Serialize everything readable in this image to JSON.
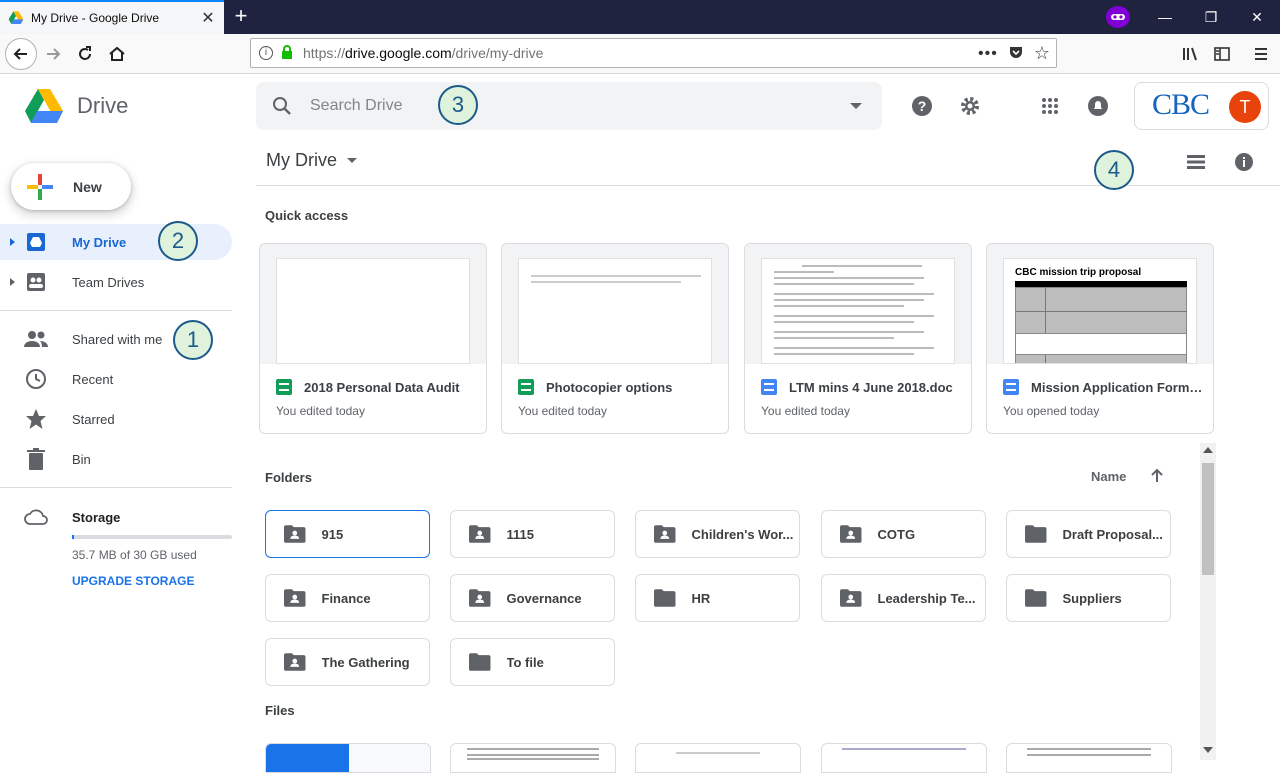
{
  "browser": {
    "tab_title": "My Drive - Google Drive",
    "url_prefix": "https://",
    "url_host": "drive.google.com",
    "url_path": "/drive/my-drive"
  },
  "header": {
    "app_name": "Drive",
    "search_placeholder": "Search Drive",
    "org_logo_text": "CBC",
    "avatar_letter": "T"
  },
  "sidebar": {
    "new_label": "New",
    "items": [
      {
        "label": "My Drive",
        "icon": "my-drive-icon",
        "active": true
      },
      {
        "label": "Team Drives",
        "icon": "team-drives-icon"
      },
      {
        "label": "Shared with me",
        "icon": "people-icon"
      },
      {
        "label": "Recent",
        "icon": "clock-icon"
      },
      {
        "label": "Starred",
        "icon": "star-icon"
      },
      {
        "label": "Bin",
        "icon": "trash-icon"
      }
    ],
    "storage": {
      "label": "Storage",
      "used_text": "35.7 MB of 30 GB used",
      "upgrade_label": "UPGRADE STORAGE"
    }
  },
  "main": {
    "breadcrumb": "My Drive",
    "quick_access_label": "Quick access",
    "quick_access": [
      {
        "name": "2018 Personal Data Audit",
        "type": "sheet",
        "sub": "You edited today"
      },
      {
        "name": "Photocopier options",
        "type": "sheet",
        "sub": "You edited today"
      },
      {
        "name": "LTM mins 4 June 2018.doc",
        "type": "doc",
        "sub": "You edited today"
      },
      {
        "name": "Mission Application Form ...",
        "type": "doc",
        "sub": "You opened today",
        "thumb_heading": "CBC mission trip proposal"
      }
    ],
    "folders_label": "Folders",
    "sort_label": "Name",
    "folders": [
      {
        "name": "915",
        "shared": true
      },
      {
        "name": "1115",
        "shared": true
      },
      {
        "name": "Children's Wor...",
        "shared": true
      },
      {
        "name": "COTG",
        "shared": true
      },
      {
        "name": "Draft Proposal...",
        "shared": false
      },
      {
        "name": "Finance",
        "shared": true
      },
      {
        "name": "Governance",
        "shared": true
      },
      {
        "name": "HR",
        "shared": false
      },
      {
        "name": "Leadership Te...",
        "shared": true
      },
      {
        "name": "Suppliers",
        "shared": false
      },
      {
        "name": "The Gathering",
        "shared": true
      },
      {
        "name": "To file",
        "shared": false
      }
    ],
    "files_label": "Files"
  },
  "annotations": [
    "1",
    "2",
    "3",
    "4"
  ],
  "colors": {
    "accent": "#1a73e8",
    "active_bg": "#e8f0fe",
    "sheet": "#0f9d58",
    "doc": "#4285f4",
    "avatar": "#e8430a"
  }
}
